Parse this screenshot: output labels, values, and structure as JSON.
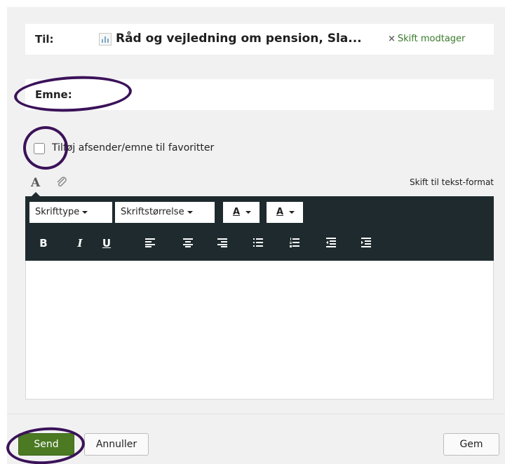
{
  "recipient": {
    "label": "Til:",
    "value": "Råd og vejledning om pension, Sla...",
    "change_label": "Skift modtager",
    "remove_glyph": "×"
  },
  "subject": {
    "label": "Emne:",
    "value": ""
  },
  "favorite": {
    "label": "Tilføj afsender/emne til favoritter",
    "checked": false
  },
  "editor_tabs": {
    "format_glyph": "A",
    "text_format_link": "Skift til tekst-format"
  },
  "toolbar": {
    "font_dropdown": "Skrifttype",
    "size_dropdown": "Skriftstørrelse",
    "text_color_glyph": "A",
    "bg_color_glyph": "A",
    "bold": "B",
    "italic": "I",
    "underline": "U"
  },
  "editor": {
    "body": ""
  },
  "actions": {
    "send": "Send",
    "cancel": "Annuller",
    "save": "Gem"
  },
  "colors": {
    "toolbar_bg": "#1e2a2e",
    "send_button": "#4b7a23",
    "link_green": "#3a7a2c",
    "annotation_ring": "#3b1259"
  }
}
